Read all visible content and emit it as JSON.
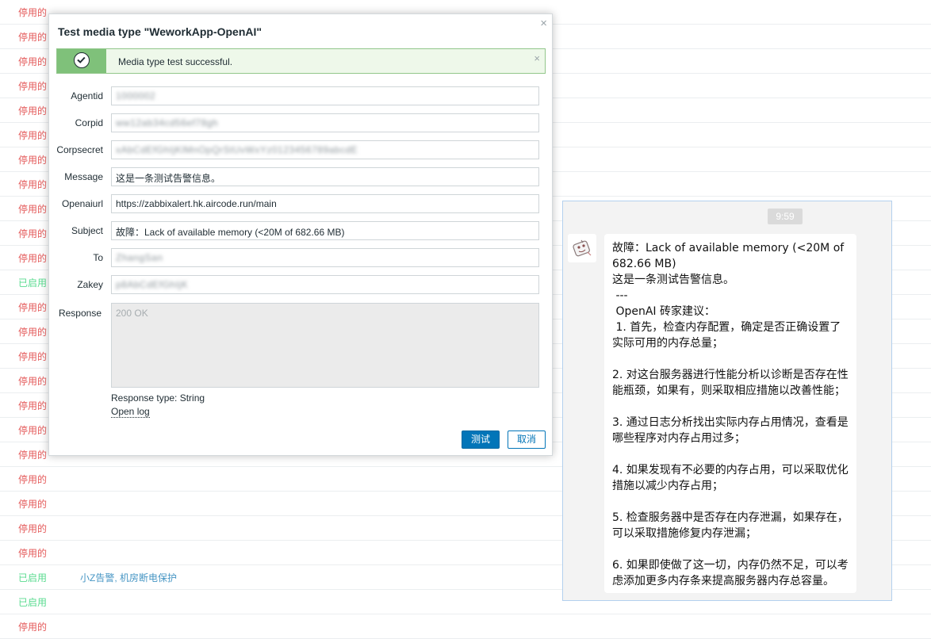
{
  "background_rows": [
    {
      "status": "停用的",
      "kind": "disabled",
      "link": ""
    },
    {
      "status": "停用的",
      "kind": "disabled",
      "link": ""
    },
    {
      "status": "停用的",
      "kind": "disabled",
      "link": ""
    },
    {
      "status": "停用的",
      "kind": "disabled",
      "link": ""
    },
    {
      "status": "停用的",
      "kind": "disabled",
      "link": ""
    },
    {
      "status": "停用的",
      "kind": "disabled",
      "link": ""
    },
    {
      "status": "停用的",
      "kind": "disabled",
      "link": ""
    },
    {
      "status": "停用的",
      "kind": "disabled",
      "link": ""
    },
    {
      "status": "停用的",
      "kind": "disabled",
      "link": ""
    },
    {
      "status": "停用的",
      "kind": "disabled",
      "link": ""
    },
    {
      "status": "停用的",
      "kind": "disabled",
      "link": ""
    },
    {
      "status": "已启用",
      "kind": "enabled",
      "link": ""
    },
    {
      "status": "停用的",
      "kind": "disabled",
      "link": ""
    },
    {
      "status": "停用的",
      "kind": "disabled",
      "link": ""
    },
    {
      "status": "停用的",
      "kind": "disabled",
      "link": ""
    },
    {
      "status": "停用的",
      "kind": "disabled",
      "link": ""
    },
    {
      "status": "停用的",
      "kind": "disabled",
      "link": ""
    },
    {
      "status": "停用的",
      "kind": "disabled",
      "link": ""
    },
    {
      "status": "停用的",
      "kind": "disabled",
      "link": ""
    },
    {
      "status": "停用的",
      "kind": "disabled",
      "link": ""
    },
    {
      "status": "停用的",
      "kind": "disabled",
      "link": ""
    },
    {
      "status": "停用的",
      "kind": "disabled",
      "link": ""
    },
    {
      "status": "停用的",
      "kind": "disabled",
      "link": ""
    },
    {
      "status": "已启用",
      "kind": "enabled",
      "link": "小Z告警, 机房断电保护"
    },
    {
      "status": "已启用",
      "kind": "enabled",
      "link": ""
    },
    {
      "status": "停用的",
      "kind": "disabled",
      "link": ""
    }
  ],
  "dialog": {
    "title": "Test media type \"WeworkApp-OpenAI\"",
    "close_symbol": "×",
    "message": {
      "text": "Media type test successful.",
      "close_symbol": "×"
    },
    "fields": [
      {
        "label": "Agentid",
        "value": "1000002",
        "blurred": true
      },
      {
        "label": "Corpid",
        "value": "ww12ab34cd56ef78gh",
        "blurred": true
      },
      {
        "label": "Corpsecret",
        "value": "xAbCdEfGhIjKlMnOpQrStUvWxYz0123456789abcdE",
        "blurred": true
      },
      {
        "label": "Message",
        "value": "这是一条测试告警信息。",
        "blurred": false
      },
      {
        "label": "Openaiurl",
        "value": "https://zabbixalert.hk.aircode.run/main",
        "blurred": false
      },
      {
        "label": "Subject",
        "value": "故障：Lack of available memory (<20M of 682.66 MB)",
        "blurred": false
      },
      {
        "label": "To",
        "value": "ZhangSan",
        "blurred": true
      },
      {
        "label": "Zakey",
        "value": "p8AbCdEfGhIjK",
        "blurred": true
      }
    ],
    "response": {
      "label": "Response",
      "value": "200 OK",
      "type_text": "Response type: String",
      "open_log": "Open log"
    },
    "buttons": {
      "test": "测试",
      "cancel": "取消"
    }
  },
  "chat": {
    "time": "9:59",
    "avatar_icon": "robot-avatar-icon",
    "message": "故障：Lack of available memory (<20M of 682.66 MB)\n这是一条测试告警信息。\n ---\n OpenAI 砖家建议：\n 1. 首先，检查内存配置，确定是否正确设置了实际可用的内存总量；\n\n2. 对这台服务器进行性能分析以诊断是否存在性能瓶颈，如果有，则采取相应措施以改善性能；\n\n3. 通过日志分析找出实际内存占用情况，查看是哪些程序对内存占用过多；\n\n4. 如果发现有不必要的内存占用，可以采取优化措施以减少内存占用；\n\n5. 检查服务器中是否存在内存泄漏，如果存在，可以采取措施修复内存泄漏；\n\n6. 如果即使做了这一切，内存仍然不足，可以考虑添加更多内存条来提高服务器内存总容量。"
  }
}
